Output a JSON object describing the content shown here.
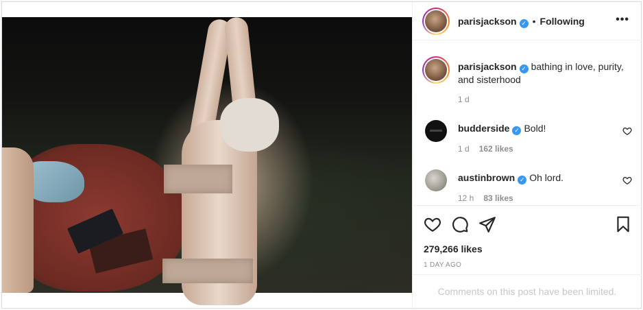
{
  "post": {
    "author": {
      "username": "parisjackson",
      "verified": true,
      "follow_status": "Following",
      "separator": "•",
      "more_glyph": "•••"
    },
    "caption": {
      "username": "parisjackson",
      "text": "bathing in love, purity, and sisterhood",
      "time": "1 d"
    },
    "comments": [
      {
        "username": "budderside",
        "verified": true,
        "text": "Bold!",
        "time": "1 d",
        "likes": "162 likes"
      },
      {
        "username": "austinbrown",
        "verified": true,
        "text": "Oh lord.",
        "time": "12 h",
        "likes": "83 likes"
      }
    ],
    "likes_count": "279,266 likes",
    "posted_ago": "1 DAY AGO",
    "comments_limited": "Comments on this post have been limited.",
    "verified_glyph": "✓"
  },
  "colors": {
    "verified": "#3897f0",
    "text": "#262626",
    "muted": "#8e8e8e",
    "limited_text": "#c7c7c7",
    "border": "#dbdbdb"
  },
  "icons": [
    "heart-icon",
    "comment-icon",
    "share-icon",
    "bookmark-icon",
    "more-options-icon",
    "verified-badge-icon"
  ]
}
